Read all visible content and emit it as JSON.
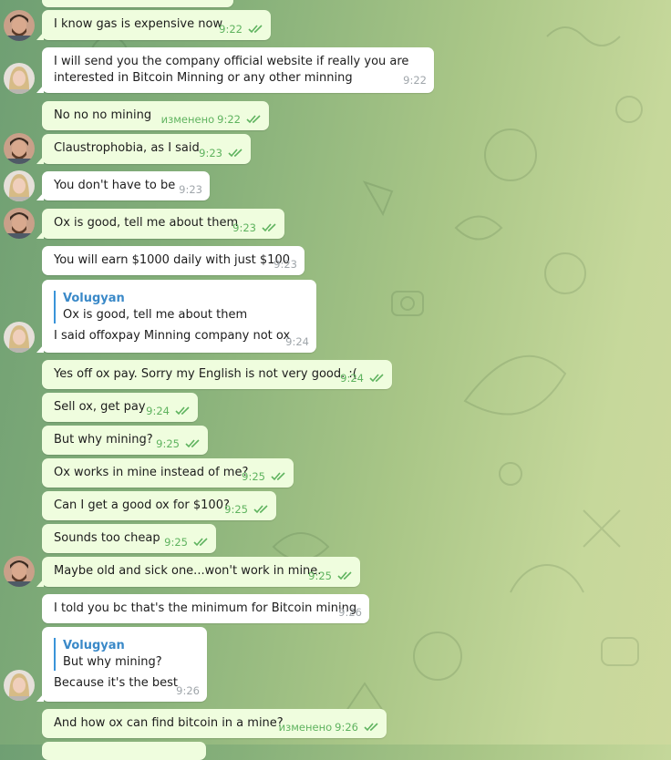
{
  "messages": [
    {
      "text": "I know gas is expensive now",
      "time": "9:22",
      "status": "read"
    },
    {
      "lines": [
        "I will send you the company official website if really you are",
        "interested in Bitcoin Minning or any other minning"
      ],
      "time": "9:22"
    },
    {
      "text": "No no no mining",
      "edited": "изменено",
      "time": "9:22",
      "status": "read"
    },
    {
      "text": "Claustrophobia, as I said",
      "time": "9:23",
      "status": "read"
    },
    {
      "text": "You don't have to be",
      "time": "9:23"
    },
    {
      "text": "Ox is good, tell me about them",
      "time": "9:23",
      "status": "read"
    },
    {
      "text": "You will earn $1000 daily with just $100",
      "time": "9:23"
    },
    {
      "reply_name": "Volugyan",
      "reply_text": "Ox is good, tell me about them",
      "text": "I said offoxpay Minning company not ox",
      "time": "9:24"
    },
    {
      "text": "Yes off ox pay. Sorry my English is not very good. :(",
      "time": "9:24",
      "status": "read"
    },
    {
      "text": "Sell ox, get pay",
      "time": "9:24",
      "status": "read"
    },
    {
      "text": "But why mining?",
      "time": "9:25",
      "status": "read"
    },
    {
      "text": "Ox works in mine instead of me?",
      "time": "9:25",
      "status": "read"
    },
    {
      "text": "Can I get a good ox  for $100?",
      "time": "9:25",
      "status": "read"
    },
    {
      "text": "Sounds too cheap",
      "time": "9:25",
      "status": "read"
    },
    {
      "text": "Maybe old and sick one...won't work in mine.",
      "time": "9:25",
      "status": "read"
    },
    {
      "text": "I told you bc that's the minimum for Bitcoin mining",
      "time": "9:26"
    },
    {
      "reply_name": "Volugyan",
      "reply_text": "But why mining?",
      "text": "Because it's the best",
      "time": "9:26"
    },
    {
      "text": "And how ox can find bitcoin in a mine?",
      "edited": "изменено",
      "time": "9:26",
      "status": "read"
    }
  ],
  "colors": {
    "outgoing_bubble": "#effdde",
    "incoming_bubble": "#ffffff",
    "read_check": "#5fb35f",
    "reply_accent": "#3a94d9"
  },
  "icons": {
    "read_status": "double-check-icon",
    "avatar_male": "avatar-male-bearded",
    "avatar_female": "avatar-female-blonde"
  }
}
